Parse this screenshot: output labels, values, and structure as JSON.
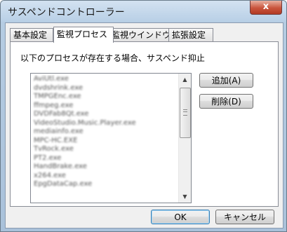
{
  "window": {
    "title": "サスペンドコントローラー",
    "close_label": "x"
  },
  "tabs": [
    {
      "label": "基本設定"
    },
    {
      "label": "監視プロセス"
    },
    {
      "label": "監視ウインドウ"
    },
    {
      "label": "拡張設定"
    }
  ],
  "panel": {
    "description": "以下のプロセスが存在する場合、サスペンド抑止",
    "list_items": [
      "AviUtl.exe",
      "dvdshrink.exe",
      "TMPGEnc.exe",
      "ffmpeg.exe",
      "DVDFab8Qt.exe",
      "VideoStudio.Music.Player.exe",
      "mediainfo.exe",
      "MPC-HC.EXE",
      "TvRock.exe",
      "PT2.exe",
      "HandBrake.exe",
      "x264.exe",
      "EpgDataCap.exe"
    ],
    "add_button": "追加(A)",
    "delete_button": "削除(D)"
  },
  "footer": {
    "ok_button": "OK",
    "cancel_button": "キャンセル"
  }
}
